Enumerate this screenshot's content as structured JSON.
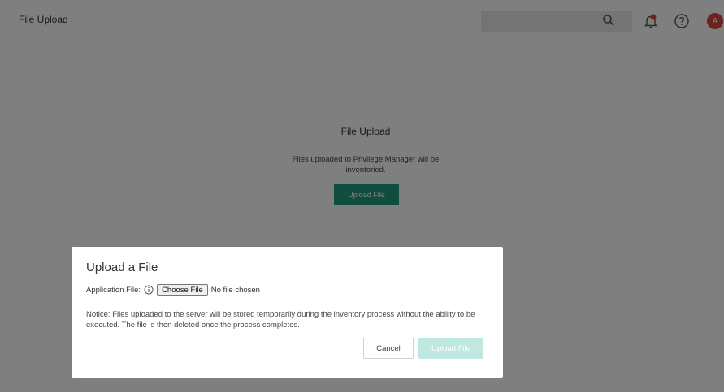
{
  "app": {
    "title": "File Upload"
  },
  "header": {
    "search_placeholder": "",
    "avatar_initial": "A",
    "icons": [
      "search-icon",
      "notification-bell-icon",
      "help-icon"
    ],
    "notification_color": "#d9443c"
  },
  "main": {
    "heading": "File Upload",
    "description": "Files uploaded to Privilege Manager will be inventoried.",
    "upload_button": "Upload File"
  },
  "modal": {
    "title": "Upload a File",
    "field_label": "Application File:",
    "choose_button": "Choose File",
    "file_status": "No file chosen",
    "notice": "Notice: Files uploaded to the server will be stored temporarily during the inventory process without the ability to be executed. The file is then deleted once the process completes.",
    "cancel_button": "Cancel",
    "upload_button": "Upload File",
    "upload_button_disabled": true
  },
  "colors": {
    "accent": "#1f9a7d",
    "accent_disabled": "#bfe8e0",
    "avatar": "#d9443c"
  }
}
